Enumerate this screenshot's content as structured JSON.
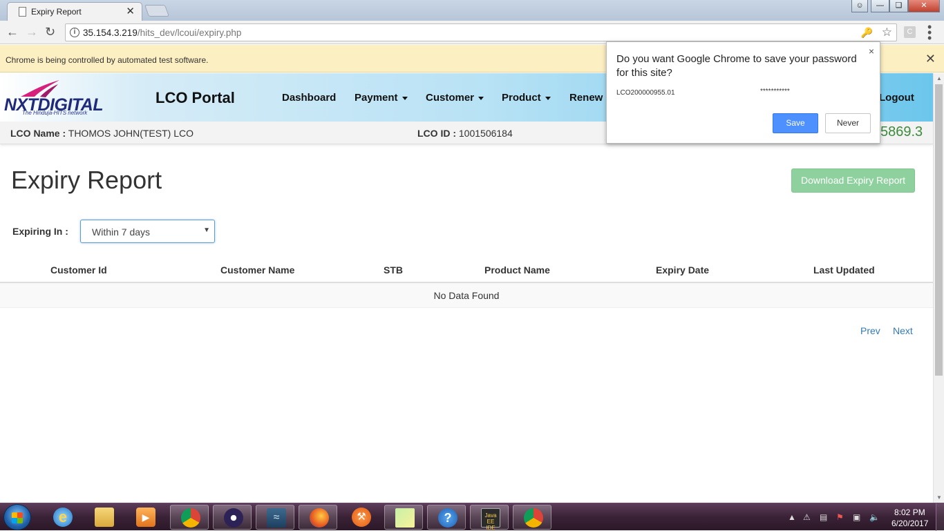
{
  "browser": {
    "tab_title": "Expiry Report",
    "tab_close": "✕",
    "url_host": "35.154.3.219",
    "url_path": "/hits_dev/lcoui/expiry.php",
    "ext_label": "C",
    "infobar_message": "Chrome is being controlled by automated test software.",
    "infobar_close": "✕"
  },
  "password_prompt": {
    "question": "Do you want Google Chrome to save your password for this site?",
    "username": "LCO200000955.01",
    "password_mask": "***********",
    "save_label": "Save",
    "never_label": "Never",
    "close": "×"
  },
  "header": {
    "logo_text": "NXTDIGITAL",
    "logo_tagline": "The Hinduja-HITS network",
    "portal_title": "LCO Portal",
    "nav": [
      {
        "label": "Dashboard",
        "dropdown": false
      },
      {
        "label": "Payment",
        "dropdown": true
      },
      {
        "label": "Customer",
        "dropdown": true
      },
      {
        "label": "Product",
        "dropdown": true
      },
      {
        "label": "Renew",
        "dropdown": true
      },
      {
        "label": "Logout",
        "dropdown": false
      }
    ]
  },
  "lco": {
    "name_label": "LCO Name :",
    "name_value": "THOMOS JOHN(TEST) LCO",
    "id_label": "LCO ID :",
    "id_value": "1001506184",
    "balance": "5869.3"
  },
  "page": {
    "heading": "Expiry Report",
    "download_label": "Download Expiry Report",
    "filter_label": "Expiring In :",
    "filter_value": "Within 7 days",
    "columns": [
      "Customer Id",
      "Customer Name",
      "STB",
      "Product Name",
      "Expiry Date",
      "Last Updated"
    ],
    "empty_message": "No Data Found",
    "prev_label": "Prev",
    "next_label": "Next"
  },
  "taskbar": {
    "time": "8:02 PM",
    "date": "6/20/2017",
    "java_label": "Java EE IDE"
  },
  "colors": {
    "accent": "#337ab7",
    "download_button": "#8fd19e",
    "balance_text": "#3c8a3c",
    "save_button": "#4d90fe",
    "infobar": "#fcefc2"
  }
}
